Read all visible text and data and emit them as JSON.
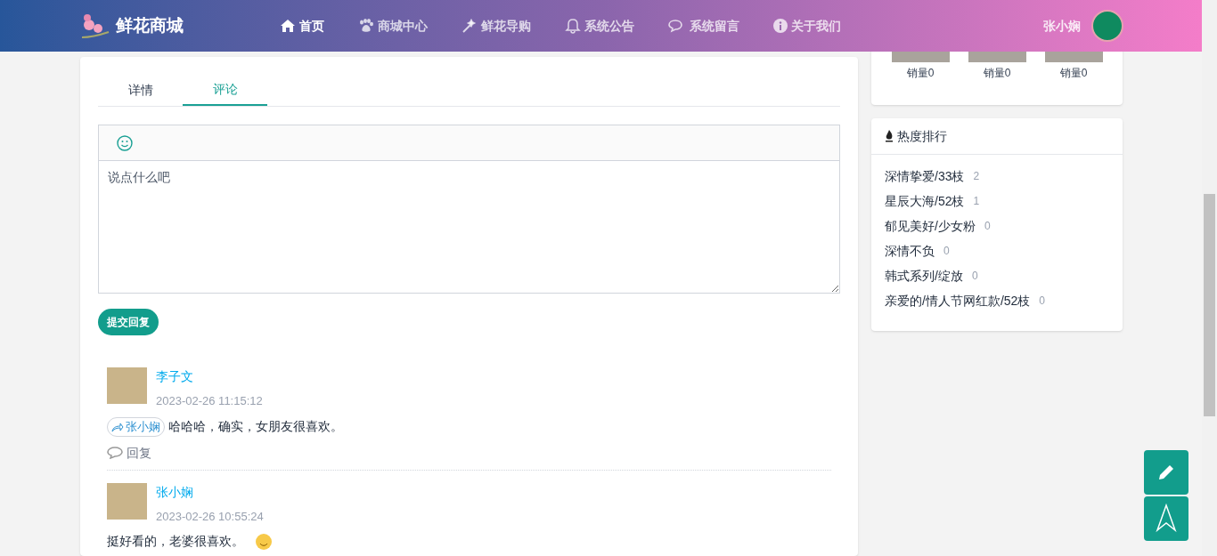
{
  "header": {
    "brand": "鲜花商城",
    "nav": [
      {
        "kind": "home",
        "label": "首页",
        "selected": true
      },
      {
        "kind": "paw",
        "label": "商城中心",
        "selected": false
      },
      {
        "kind": "wand",
        "label": "鲜花导购",
        "selected": false
      },
      {
        "kind": "bell",
        "label": "系统公告",
        "selected": false
      },
      {
        "kind": "chat",
        "label": "系统留言",
        "selected": false
      },
      {
        "kind": "info",
        "label": "关于我们",
        "selected": false
      }
    ],
    "username": "张小娴"
  },
  "tabs": [
    {
      "label": "详情",
      "selected": false
    },
    {
      "label": "评论",
      "selected": true
    }
  ],
  "editor": {
    "placeholder": "说点什么吧",
    "submit": "提交回复"
  },
  "comments": [
    {
      "author": "李子文",
      "time": "2023-02-26 11:15:12",
      "reply_to": "张小娴",
      "text": "哈哈哈，确实，女朋友很喜欢。",
      "reply_label": "回复",
      "emoji": false
    },
    {
      "author": "张小娴",
      "time": "2023-02-26 10:55:24",
      "text": "挺好看的，老婆很喜欢。",
      "emoji": true
    }
  ],
  "products": [
    {
      "sales": "销量0"
    },
    {
      "sales": "销量0"
    },
    {
      "sales": "销量0"
    }
  ],
  "ranking": {
    "title": "热度排行",
    "items": [
      {
        "name": "深情挚爱/33枝",
        "count": "2"
      },
      {
        "name": "星辰大海/52枝",
        "count": "1"
      },
      {
        "name": "郁见美好/少女粉",
        "count": "0"
      },
      {
        "name": "深情不负",
        "count": "0"
      },
      {
        "name": "韩式系列/绽放",
        "count": "0"
      },
      {
        "name": "亲爱的/情人节网红款/52枝",
        "count": "0"
      }
    ]
  }
}
